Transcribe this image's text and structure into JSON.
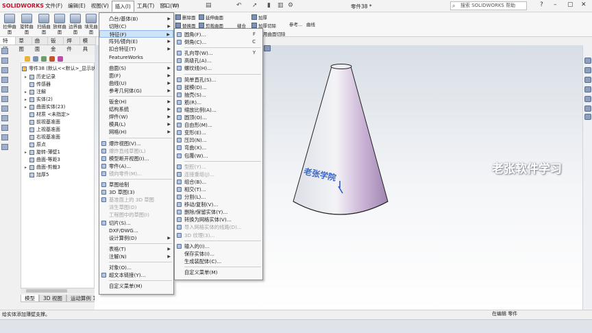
{
  "app": {
    "logo": "SOLIDWORKS",
    "document_title": "零件38 *",
    "search_placeholder": "搜索 SOLIDWORKS 帮助"
  },
  "menubar": [
    "文件(F)",
    "编辑(E)",
    "视图(V)",
    "插入(I)",
    "工具(T)",
    "窗口(W)"
  ],
  "ribbon": {
    "tools": [
      "拉伸曲面",
      "旋转曲面",
      "扫描曲面",
      "放样曲面",
      "边界曲面",
      "填充曲面"
    ],
    "small_tools": [
      "删除面",
      "替换面",
      "延伸曲面",
      "剪裁曲面",
      "缝合",
      "加厚",
      "加厚切除",
      "参考...",
      "曲线",
      "用曲面切除"
    ]
  },
  "command_tabs": [
    "特征",
    "草图",
    "曲面",
    "钣金",
    "焊件",
    "模具"
  ],
  "tree": {
    "header": "零件38 (默认<<默认>_显示状",
    "items": [
      {
        "label": "历史记录",
        "expand": "▸"
      },
      {
        "label": "传感器",
        "expand": ""
      },
      {
        "label": "注解",
        "expand": "▸"
      },
      {
        "label": "实体(2)",
        "expand": "▸"
      },
      {
        "label": "曲面实体(23)",
        "expand": "▸"
      },
      {
        "label": "材质 <未指定>",
        "expand": ""
      },
      {
        "label": "前视基准面",
        "expand": ""
      },
      {
        "label": "上视基准面",
        "expand": ""
      },
      {
        "label": "右视基准面",
        "expand": ""
      },
      {
        "label": "原点",
        "expand": ""
      },
      {
        "label": "旋转-薄壁1",
        "expand": "▸"
      },
      {
        "label": "曲面-等距3",
        "expand": ""
      },
      {
        "label": "曲面-剪裁3",
        "expand": "▸"
      },
      {
        "label": "加厚5",
        "expand": ""
      }
    ]
  },
  "bottom_tabs": [
    "模型",
    "3D 视图",
    "运动算例 1"
  ],
  "status": {
    "left": "给实体添加薄壁支撑。",
    "right": "在编辑",
    "right2": "零件"
  },
  "watermark": "老张软件学习",
  "model_label": "老张学院",
  "insert_menu": {
    "items": [
      {
        "label": "凸台/基体(B)",
        "arrow": true
      },
      {
        "label": "切除(C)",
        "arrow": true
      },
      {
        "label": "特征(F)",
        "arrow": true,
        "highlight": true
      },
      {
        "label": "阵列/镜向(E)",
        "arrow": true
      },
      {
        "label": "扣合特征(T)",
        "arrow": true
      },
      {
        "label": "FeatureWorks",
        "arrow": false
      },
      {
        "sep": true
      },
      {
        "label": "曲面(S)",
        "arrow": true
      },
      {
        "label": "面(F)",
        "arrow": true
      },
      {
        "label": "曲线(U)",
        "arrow": true
      },
      {
        "label": "参考几何体(G)",
        "arrow": true
      },
      {
        "sep": true
      },
      {
        "label": "钣金(H)",
        "arrow": true
      },
      {
        "label": "结构系统",
        "arrow": true
      },
      {
        "label": "焊件(W)",
        "arrow": true
      },
      {
        "label": "模具(L)",
        "arrow": true
      },
      {
        "label": "网格(H)",
        "arrow": true
      },
      {
        "sep": true
      },
      {
        "label": "爆炸视图(V)...",
        "icon": true
      },
      {
        "label": "爆炸直线草图(L)",
        "icon": true,
        "disabled": true
      },
      {
        "label": "模型断开视图(I)...",
        "icon": true
      },
      {
        "label": "零件(A)...",
        "icon": true
      },
      {
        "label": "镜向零件(M)...",
        "icon": true,
        "disabled": true
      },
      {
        "sep": true
      },
      {
        "label": "草图绘制",
        "icon": true
      },
      {
        "label": "3D 草图(3)",
        "icon": true
      },
      {
        "label": "基准面上的 3D 草图",
        "icon": true,
        "disabled": true
      },
      {
        "label": "派生草图(D)",
        "disabled": true
      },
      {
        "label": "工程图中的草图(I)",
        "disabled": true
      },
      {
        "label": "切片(S)...",
        "icon": true
      },
      {
        "label": "DXF/DWG...",
        "arrow": false
      },
      {
        "label": "设计算例(D)",
        "arrow": true
      },
      {
        "sep": true
      },
      {
        "label": "表格(T)",
        "arrow": true
      },
      {
        "label": "注解(N)",
        "arrow": true
      },
      {
        "sep": true
      },
      {
        "label": "对象(O)...",
        "arrow": false
      },
      {
        "label": "超文本链接(Y)...",
        "icon": true
      },
      {
        "sep": true
      },
      {
        "label": "自定义菜单(M)",
        "arrow": false
      }
    ]
  },
  "feature_menu": {
    "items": [
      {
        "label": "圆角(F)...",
        "key": "F",
        "icon": true
      },
      {
        "label": "倒角(C)...",
        "key": "C",
        "icon": true
      },
      {
        "sep": true
      },
      {
        "label": "孔向导(W)...",
        "key": "Y",
        "icon": true
      },
      {
        "label": "高级孔(A)...",
        "icon": true
      },
      {
        "label": "螺纹线(H)...",
        "icon": true
      },
      {
        "sep": true
      },
      {
        "label": "简单直孔(S)...",
        "icon": true
      },
      {
        "label": "拔模(D)...",
        "icon": true
      },
      {
        "label": "抽壳(S)...",
        "icon": true
      },
      {
        "label": "筋(R)...",
        "icon": true
      },
      {
        "label": "缩放比例(A)...",
        "icon": true
      },
      {
        "label": "圆顶(O)...",
        "icon": true
      },
      {
        "label": "自由形(M)...",
        "icon": true
      },
      {
        "label": "变形(E)...",
        "icon": true
      },
      {
        "label": "压凹(N)...",
        "icon": true
      },
      {
        "label": "弯曲(X)...",
        "icon": true
      },
      {
        "label": "包覆(W)...",
        "icon": true
      },
      {
        "sep": true
      },
      {
        "label": "型腔(Y)...",
        "icon": true,
        "disabled": true
      },
      {
        "label": "连接重组(J)...",
        "icon": true,
        "disabled": true
      },
      {
        "label": "组合(B)...",
        "icon": true
      },
      {
        "label": "相交(T)...",
        "icon": true
      },
      {
        "label": "分割(L)...",
        "icon": true
      },
      {
        "label": "移动/复制(V)...",
        "icon": true
      },
      {
        "label": "删除/保留实体(Y)...",
        "icon": true
      },
      {
        "label": "转换为网格实体(V)...",
        "icon": true
      },
      {
        "label": "导入网格实体的线路(D)...",
        "icon": true,
        "disabled": true
      },
      {
        "label": "3D 纹理(3)...",
        "icon": true,
        "disabled": true
      },
      {
        "sep": true
      },
      {
        "label": "输入的(I)...",
        "icon": true
      },
      {
        "label": "保存实体(I)...",
        "arrow": false
      },
      {
        "label": "生成装配体(C)...",
        "arrow": false
      },
      {
        "sep": true
      },
      {
        "label": "自定义菜单(M)",
        "arrow": false
      }
    ]
  }
}
